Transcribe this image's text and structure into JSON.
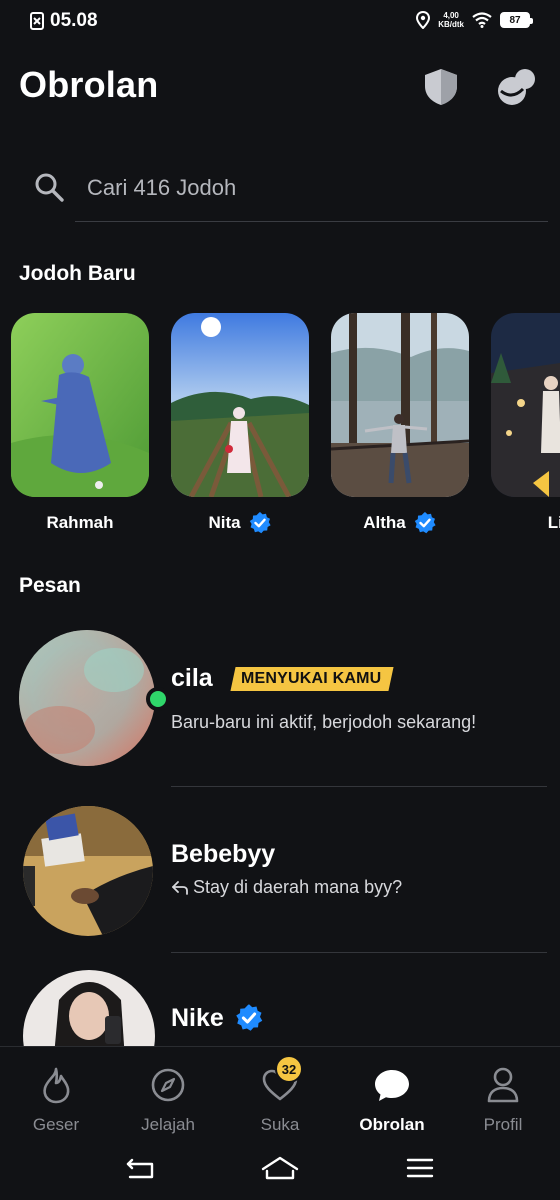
{
  "status_bar": {
    "time": "05.08",
    "speed_value": "4,00",
    "speed_unit": "KB/dtk",
    "battery": "87"
  },
  "header": {
    "title": "Obrolan",
    "icons": [
      "shield-icon",
      "bubbles-icon"
    ]
  },
  "search": {
    "placeholder": "Cari 416 Jodoh"
  },
  "new_matches": {
    "title": "Jodoh Baru",
    "items": [
      {
        "name": "Rahmah",
        "verified": false
      },
      {
        "name": "Nita",
        "verified": true
      },
      {
        "name": "Altha",
        "verified": true
      },
      {
        "name": "Lia",
        "verified": false
      }
    ]
  },
  "messages": {
    "title": "Pesan",
    "items": [
      {
        "name": "cila",
        "tag": "MENYUKAI KAMU",
        "preview": "Baru-baru ini aktif, berjodoh sekarang!",
        "online": true,
        "verified": false
      },
      {
        "name": "Bebebyy",
        "preview": "Stay di daerah mana byy?",
        "replied": true,
        "verified": false
      },
      {
        "name": "Nike",
        "preview": "",
        "verified": true
      }
    ]
  },
  "bottom_nav": {
    "items": [
      {
        "label": "Geser",
        "icon": "flame-icon",
        "active": false
      },
      {
        "label": "Jelajah",
        "icon": "compass-icon",
        "active": false
      },
      {
        "label": "Suka",
        "icon": "heart-icon",
        "active": false,
        "badge": "32"
      },
      {
        "label": "Obrolan",
        "icon": "chat-icon",
        "active": true
      },
      {
        "label": "Profil",
        "icon": "profile-icon",
        "active": false
      }
    ]
  },
  "colors": {
    "background": "#111215",
    "accent_gold": "#f5c542",
    "verified_blue": "#1f8bff",
    "online_green": "#2fd66a"
  }
}
